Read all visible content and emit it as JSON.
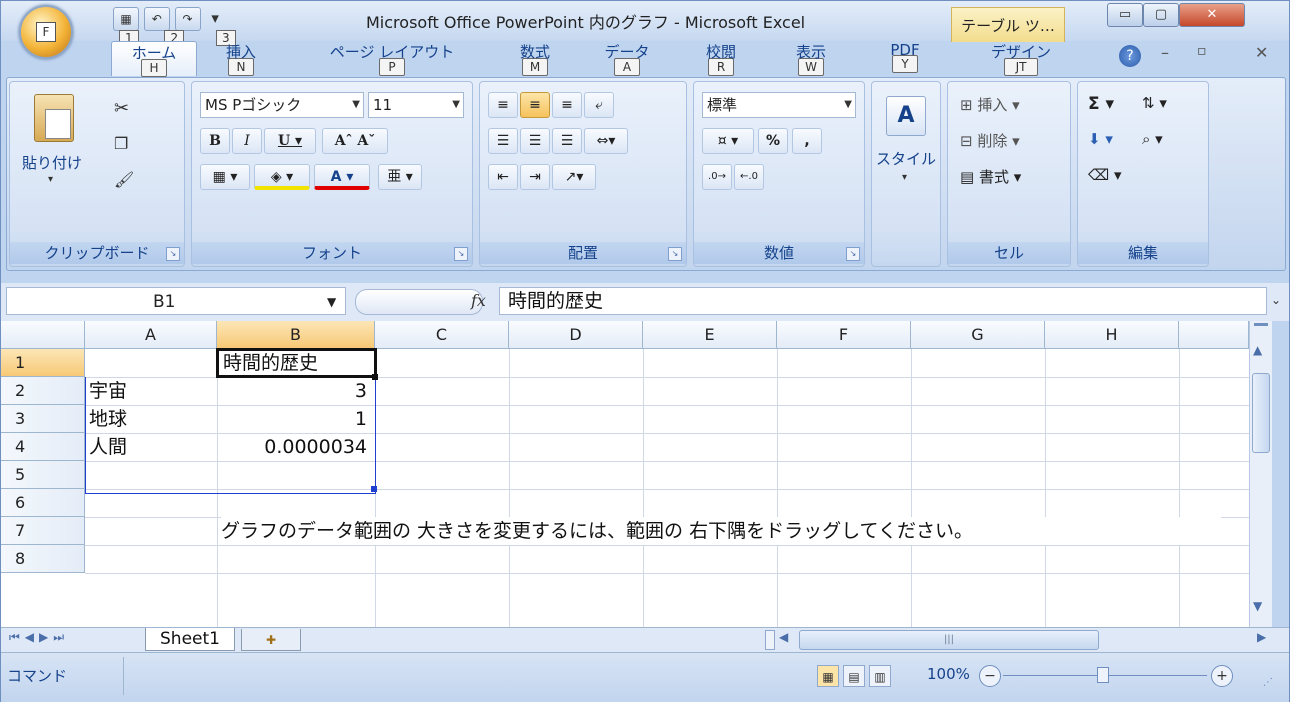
{
  "window": {
    "title": "Microsoft Office PowerPoint 内のグラフ - Microsoft Excel",
    "context_tab": "テーブル ツ…",
    "office_key": "F",
    "qat_keys": [
      "1",
      "2",
      "3"
    ]
  },
  "ribbon_tabs": [
    {
      "label": "ホーム",
      "key": "H"
    },
    {
      "label": "挿入",
      "key": "N"
    },
    {
      "label": "ページ レイアウト",
      "key": "P"
    },
    {
      "label": "数式",
      "key": "M"
    },
    {
      "label": "データ",
      "key": "A"
    },
    {
      "label": "校閲",
      "key": "R"
    },
    {
      "label": "表示",
      "key": "W"
    },
    {
      "label": "PDF",
      "key": "Y"
    },
    {
      "label": "デザイン",
      "key": "JT"
    }
  ],
  "ribbon": {
    "clipboard": {
      "label": "クリップボード",
      "paste": "貼り付け"
    },
    "font": {
      "label": "フォント",
      "name": "MS Pゴシック",
      "size": "11"
    },
    "alignment": {
      "label": "配置"
    },
    "number": {
      "label": "数値",
      "format": "標準"
    },
    "styles": {
      "label": "スタイル"
    },
    "cells": {
      "label": "セル",
      "insert": "挿入",
      "delete": "削除",
      "format": "書式"
    },
    "editing": {
      "label": "編集"
    }
  },
  "formula_bar": {
    "name_box": "B1",
    "fx": "fx",
    "value": "時間的歴史"
  },
  "sheet": {
    "columns": [
      "A",
      "B",
      "C",
      "D",
      "E",
      "F",
      "G",
      "H"
    ],
    "rows": [
      "1",
      "2",
      "3",
      "4",
      "5",
      "6",
      "7",
      "8"
    ],
    "cells": {
      "B1": "時間的歴史",
      "A2": "宇宙",
      "B2": "3",
      "A3": "地球",
      "B3": "1",
      "A4": "人間",
      "B4": "0.0000034",
      "B7": "グラフのデータ範囲の 大きさを変更するには、範囲の 右下隅をドラッグしてください。"
    }
  },
  "sheet_tabs": [
    "Sheet1"
  ],
  "status": {
    "mode": "コマンド",
    "zoom": "100%"
  }
}
